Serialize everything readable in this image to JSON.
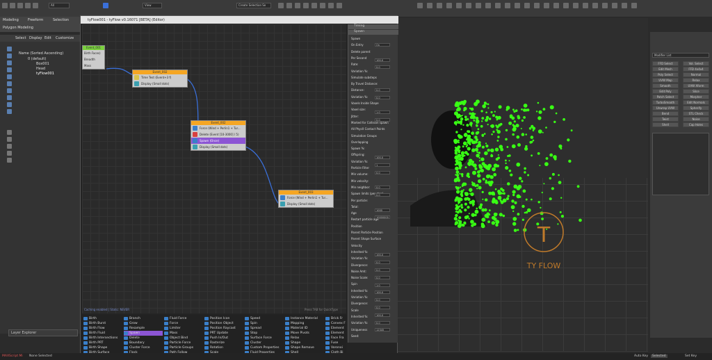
{
  "ribbon": {
    "tabs": [
      "Modeling",
      "Freeform",
      "Selection"
    ],
    "sub": "Polygon Modeling"
  },
  "toolbar": {
    "view_dropdown": "View",
    "all_dropdown": "All",
    "selset": "Create Selection Se"
  },
  "scene_explorer": {
    "menus": [
      "Select",
      "Display",
      "Edit",
      "Customize"
    ],
    "header": "Name (Sorted Ascending)",
    "items": [
      "0 (default)",
      "Box001",
      "Head",
      "tyFlow001"
    ]
  },
  "layer_explorer": "Layer Explorer",
  "status": {
    "script": "MAXScript Mi",
    "left_text": "None Selected",
    "selected": "Selected",
    "autokey": "Auto Key",
    "setkey": "Set Key"
  },
  "tyflow": {
    "title": "tyFlow001 - tyFlow v0.16071 [BETA] (Editor)",
    "caching": "Caching enabled | Static: NEVER",
    "quicktype": "Press TAB for QuickType",
    "nodes": [
      {
        "name": "Event_001",
        "rows": [
          "Birth Faces)",
          "Breadth",
          "Mass"
        ]
      },
      {
        "name": "Event_002",
        "rows": [
          "Time Test (Event+3 f)",
          "Display (Small dots)"
        ]
      },
      {
        "name": "Event_002",
        "rows": [
          "Force (Wind + Perlin1 + Tur...",
          "Delete (Event [10-3000] / 5)",
          "Spawn (Once)",
          "Display (Small dots)"
        ]
      },
      {
        "name": "Event_003",
        "rows": [
          "Force (Wind + Perlin1 + Tur...",
          "Display (Small dots)"
        ]
      }
    ],
    "props": {
      "timing": "Timing",
      "spawn": "Spawn",
      "labels": [
        "Spawn",
        "On Entry",
        "Delete parent",
        "Per Second",
        "Rate:",
        "Variation %:",
        "Simulate substeps",
        "By Travel Distance:",
        "Distance:",
        "Variation %:",
        "Voxels Inside Shape",
        "Voxel size:",
        "Jitter:",
        "Marked for Collision spawn",
        "All PhysX Contact Points",
        "Simulation Groups",
        "Overlapping",
        "Spawn %:",
        "Offspring:",
        "Variation %:",
        "Particle Filter",
        "Min volume:",
        "Min velocity:",
        "Min neighbor:",
        "Spawn limits (per step)",
        "Per particle:",
        "Total:",
        "Age",
        "Restart particle age",
        "Position",
        "Parent Particle Position",
        "Parent Shape Surface",
        "Velocity",
        "Inherited %:",
        "Variation %:",
        "Divergence:",
        "Noise Amt:",
        "Noise Scale:",
        "Spin",
        "Inherited %:",
        "Variation %:",
        "Divergence:",
        "Scale",
        "Inherited %:",
        "Variation %:",
        "Uniqueness",
        "Seed:"
      ],
      "values": [
        "On",
        "",
        "100.0",
        "0.0",
        "",
        "",
        "0.0",
        "0.0",
        "",
        "1.0",
        "0.0",
        "",
        "",
        "",
        "",
        "100.0",
        "1",
        "0.0",
        "",
        "0.0",
        "0.0",
        "",
        "1000",
        "10000000",
        "",
        "",
        "",
        "",
        "100.0",
        "0.0",
        "0.0",
        "0.0",
        "1.0",
        "100.0",
        "0.0",
        "0.0",
        "100.0",
        "0.0",
        "12345"
      ]
    },
    "operators": [
      [
        "Birth",
        "Birth Burst",
        "Birth Flow",
        "Birth Fluid",
        "Birth Intersections",
        "Birth PRT",
        "Birth Shape",
        "Birth Surface",
        "Birth Voxels"
      ],
      [
        "Branch",
        "Grow",
        "Resample",
        "Spawn",
        "Delete",
        "Boundary",
        "Cluster Force",
        "Flock",
        "Flow Update"
      ],
      [
        "Fluid Force",
        "Force",
        "Limiter",
        "Mass",
        "Object Bind",
        "Particle Force",
        "Particle Groups",
        "Path Follow",
        "Point Force"
      ],
      [
        "Position Icon",
        "Position Object",
        "Position Raycast",
        "PRT Update",
        "Push In/Out",
        "Rasterize",
        "Rotation",
        "Scale",
        "Slow"
      ],
      [
        "Speed",
        "Spin",
        "Spread",
        "Stop",
        "Surface Force",
        "Cluster",
        "Custom Properties",
        "Fluid Properties",
        "Script"
      ],
      [
        "Instance Material",
        "Mapping",
        "Material ID",
        "Move Pivots",
        "Relax",
        "Shape",
        "Shape Remove",
        "Shell",
        "Subdivide"
      ],
      [
        "Brick Fr",
        "Convex F",
        "Element",
        "Element",
        "Face Fra",
        "Fuse",
        "Voronoi",
        "Cloth Bi",
        "Cloth Co"
      ]
    ]
  },
  "cmdpanel": {
    "modifier_list": "Modifier List",
    "buttons": [
      "FFD Select",
      "Vol. Select",
      "Edit Mesh",
      "FFD 4x4x4",
      "Poly Select",
      "Normal",
      "UVW Map",
      "Relax",
      "Smooth",
      "UVW Xform",
      "Edit Poly",
      "Slice",
      "Patch Select",
      "Morpher",
      "TurboSmooth",
      "Edit Normals",
      "Unwrap UVW",
      "Spherify",
      "Bend",
      "STL Check",
      "Twist",
      "Noise",
      "Shell",
      "Cap Holes"
    ]
  },
  "viewport": {
    "logo": "TY FLOW",
    "particle_color": "#39ff14"
  },
  "colors": {
    "node_header": "#f5a623",
    "node_header_first": "#7bd13f",
    "selection": "#8c55d4",
    "link": "#3a6fd8",
    "ops_icon": "#3a7fc9"
  }
}
